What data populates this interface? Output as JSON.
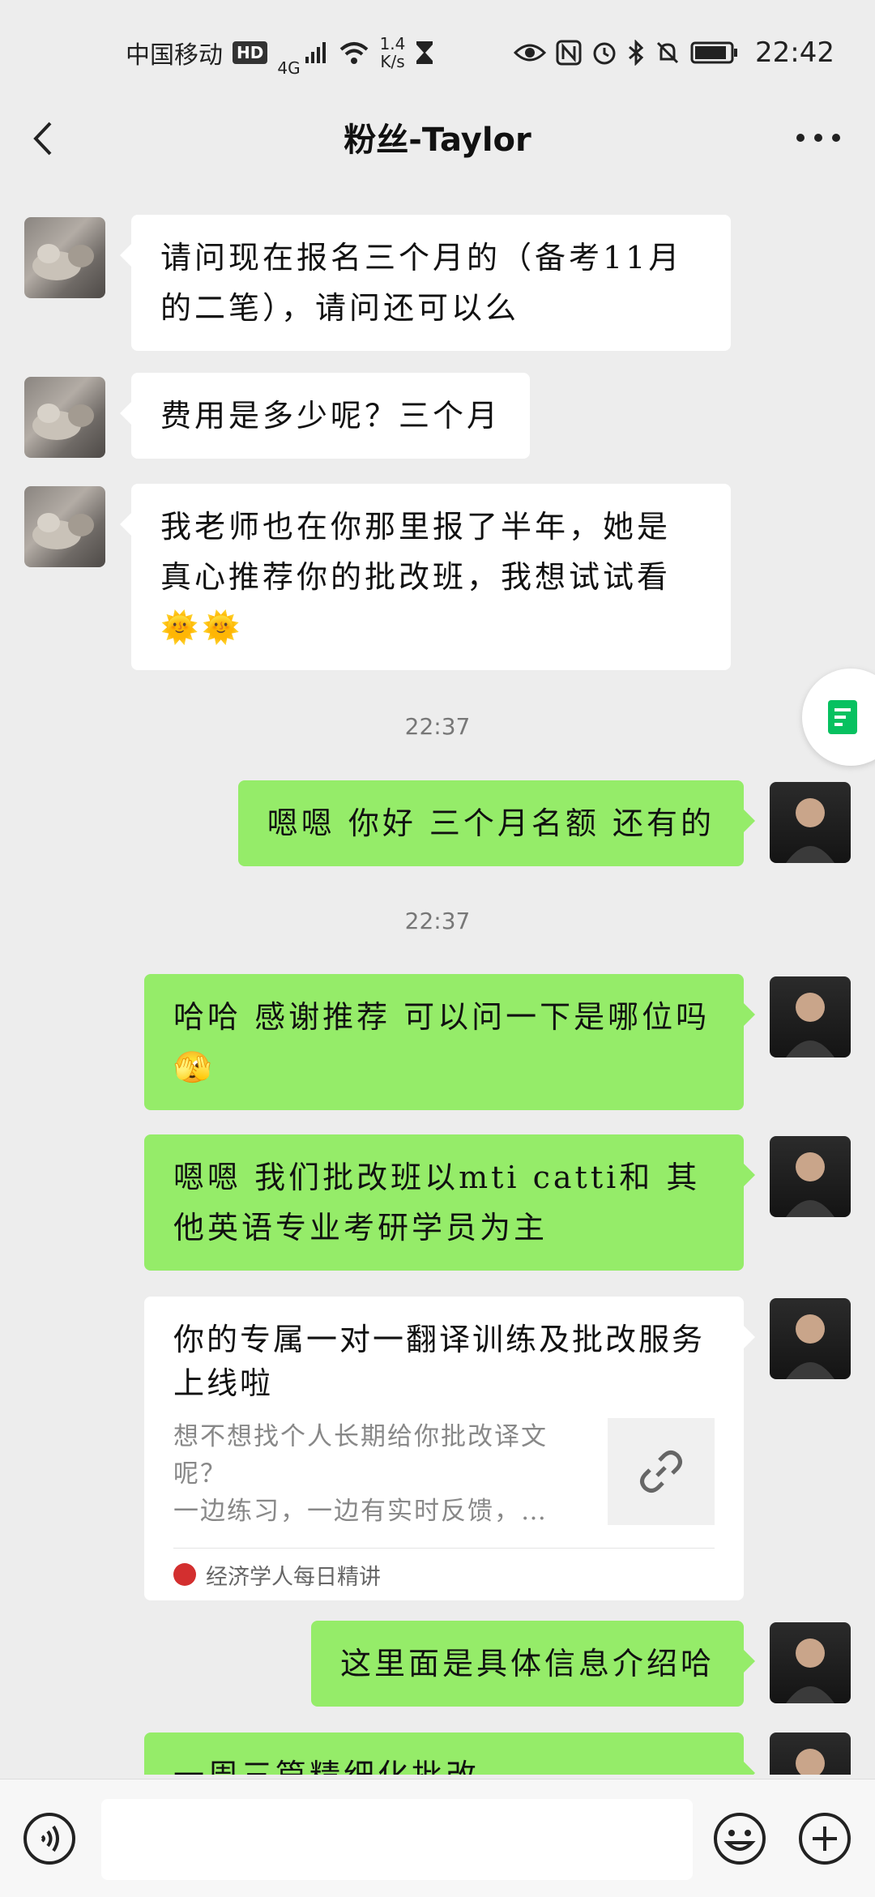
{
  "status_bar": {
    "carrier": "中国移动",
    "hd": "HD",
    "network": "4G",
    "speed_value": "1.4",
    "speed_unit": "K/s",
    "time": "22:42"
  },
  "nav": {
    "title": "粉丝-Taylor"
  },
  "messages": [
    {
      "side": "in",
      "text": "请问现在报名三个月的（备考11月的二笔），请问还可以么"
    },
    {
      "side": "in",
      "text": "费用是多少呢？三个月"
    },
    {
      "side": "in",
      "text": "我老师也在你那里报了半年，她是真心推荐你的批改班，我想试试看🌞🌞"
    },
    {
      "side": "time",
      "text": "22:37"
    },
    {
      "side": "out",
      "text": "嗯嗯 你好 三个月名额 还有的"
    },
    {
      "side": "time",
      "text": "22:37"
    },
    {
      "side": "out",
      "text": "哈哈 感谢推荐 可以问一下是哪位吗🫣"
    },
    {
      "side": "out",
      "text": "嗯嗯 我们批改班以mti catti和 其他英语专业考研学员为主"
    },
    {
      "side": "out",
      "text": "这里面是具体信息介绍哈"
    },
    {
      "side": "out",
      "text": "一周三篇精细化批改"
    }
  ],
  "link_card": {
    "title": "你的专属一对一翻译训练及批改服务上线啦",
    "description": "想不想找个人长期给你批改译文呢？\n一边练习，一边有实时反馈，…",
    "source": "经济学人每日精讲"
  },
  "icons": {
    "back": "back-arrow-icon",
    "more": "more-dots-icon",
    "voice": "voice-icon",
    "emoji": "emoji-icon",
    "plus": "plus-icon",
    "link": "link-icon",
    "float": "document-icon"
  },
  "colors": {
    "background": "#ededed",
    "outgoing_bubble": "#95ec69",
    "incoming_bubble": "#ffffff",
    "accent_green": "#07c160"
  }
}
